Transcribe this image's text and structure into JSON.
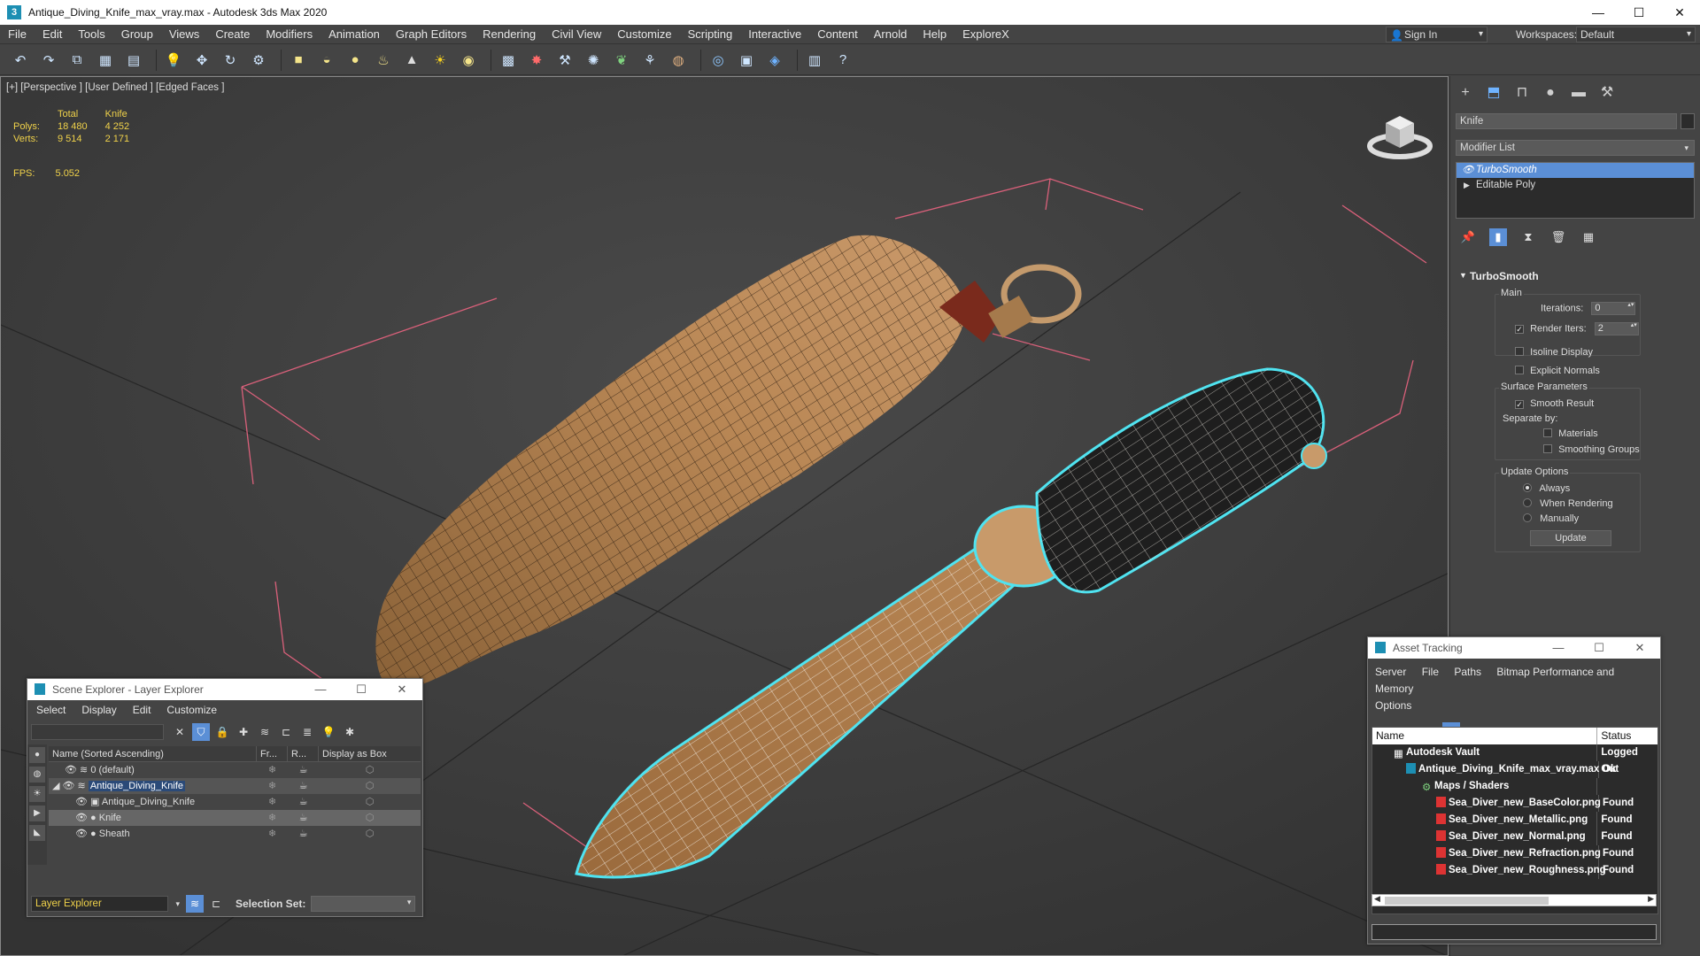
{
  "window": {
    "title": "Antique_Diving_Knife_max_vray.max - Autodesk 3ds Max 2020",
    "minimize": "—",
    "maximize": "☐",
    "close": "✕"
  },
  "menu": {
    "items": [
      "File",
      "Edit",
      "Tools",
      "Group",
      "Views",
      "Create",
      "Modifiers",
      "Animation",
      "Graph Editors",
      "Rendering",
      "Civil View",
      "Customize",
      "Scripting",
      "Interactive",
      "Content",
      "Arnold",
      "Help",
      "ExploreX"
    ],
    "sign_in": "Sign In",
    "workspaces_label": "Workspaces:",
    "workspace_value": "Default"
  },
  "toolbar": {
    "icons": [
      "undo-icon",
      "redo-icon",
      "link-icon",
      "unlink-icon",
      "bind-icon",
      "selection-filter-icon",
      "select-icon",
      "select-region-icon",
      "select-by-name-icon",
      "move-icon",
      "rotate-icon",
      "scale-icon",
      "box-icon",
      "sphere-icon",
      "cylinder-icon",
      "teapot-icon",
      "cone-icon",
      "sun-icon",
      "light-icon",
      "grid-icon",
      "particle-icon",
      "bone-icon",
      "helper-icon",
      "hair-icon",
      "fur-icon",
      "material-icon",
      "render-setup-icon",
      "render-frame-icon",
      "render-icon",
      "scene-icon",
      "help-icon"
    ]
  },
  "viewport": {
    "label": "[+] [Perspective ] [User Defined ] [Edged Faces ]",
    "stats": {
      "col_total": "Total",
      "col_object": "Knife",
      "polys_label": "Polys:",
      "polys_total": "18 480",
      "polys_object": "4 252",
      "verts_label": "Verts:",
      "verts_total": "9 514",
      "verts_object": "2 171"
    },
    "fps_label": "FPS:",
    "fps_value": "5.052"
  },
  "command_panel": {
    "object_name": "Knife",
    "modifier_list": "Modifier List",
    "stack": [
      "TurboSmooth",
      "Editable Poly"
    ],
    "rollout_title": "TurboSmooth",
    "main_label": "Main",
    "iterations_label": "Iterations:",
    "iterations_value": "0",
    "render_iters_label": "Render Iters:",
    "render_iters_value": "2",
    "isoline_display": "Isoline Display",
    "explicit_normals": "Explicit Normals",
    "surface_params": "Surface Parameters",
    "smooth_result": "Smooth Result",
    "separate_by": "Separate by:",
    "materials": "Materials",
    "smoothing_groups": "Smoothing Groups",
    "update_options": "Update Options",
    "always": "Always",
    "when_rendering": "When Rendering",
    "manually": "Manually",
    "update_button": "Update"
  },
  "scene_explorer": {
    "title": "Scene Explorer - Layer Explorer",
    "menu": [
      "Select",
      "Display",
      "Edit",
      "Customize"
    ],
    "columns": [
      "Name (Sorted Ascending)",
      "Fr...",
      "R...",
      "Display as Box"
    ],
    "rows": [
      "0 (default)",
      "Antique_Diving_Knife",
      "Antique_Diving_Knife",
      "Knife",
      "Sheath"
    ],
    "layer_explorer": "Layer Explorer",
    "selection_set_label": "Selection Set:"
  },
  "asset_tracking": {
    "title": "Asset Tracking",
    "menu": [
      "Server",
      "File",
      "Paths",
      "Bitmap Performance and Memory",
      "Options"
    ],
    "col_name": "Name",
    "col_status": "Status",
    "rows": [
      {
        "name": "Autodesk Vault",
        "status": "Logged Out"
      },
      {
        "name": "Antique_Diving_Knife_max_vray.max",
        "status": "Ok"
      },
      {
        "name": "Maps / Shaders",
        "status": ""
      },
      {
        "name": "Sea_Diver_new_BaseColor.png",
        "status": "Found"
      },
      {
        "name": "Sea_Diver_new_Metallic.png",
        "status": "Found"
      },
      {
        "name": "Sea_Diver_new_Normal.png",
        "status": "Found"
      },
      {
        "name": "Sea_Diver_new_Refraction.png",
        "status": "Found"
      },
      {
        "name": "Sea_Diver_new_Roughness.png",
        "status": "Found"
      }
    ]
  },
  "colors": {
    "selection_blue": "#5b8fd6",
    "stats_yellow": "#f0d24a",
    "selection_outline": "#4fe3f0",
    "bbox_pink": "#d9607a",
    "model_tan": "#b98755"
  }
}
